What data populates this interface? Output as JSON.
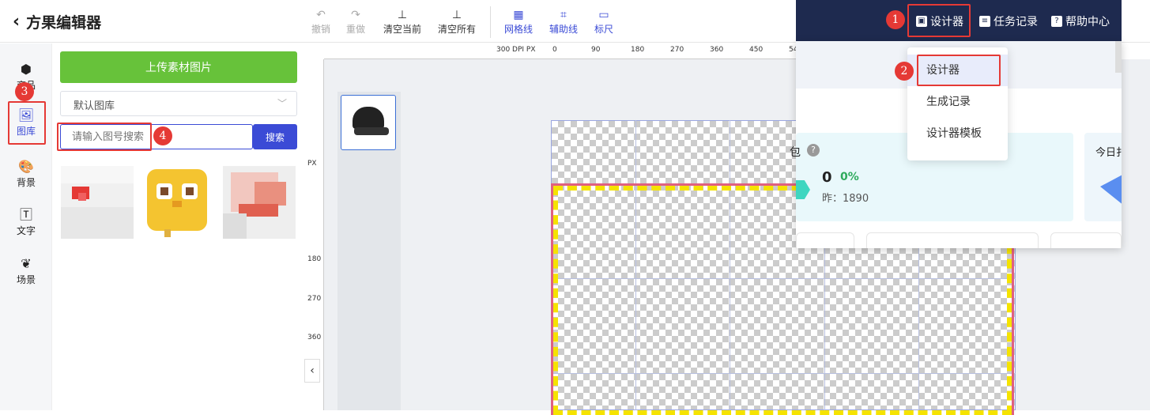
{
  "header": {
    "title": "方果编辑器"
  },
  "toolbar": {
    "undo": "撤销",
    "redo": "重做",
    "clear_current": "清空当前",
    "clear_all": "清空所有",
    "gridlines": "网格线",
    "guides": "辅助线",
    "ruler": "标尺"
  },
  "left_nav": {
    "items": [
      {
        "label": "商品",
        "icon": "box-icon"
      },
      {
        "label": "图库",
        "icon": "image-icon"
      },
      {
        "label": "背景",
        "icon": "palette-icon"
      },
      {
        "label": "文字",
        "icon": "text-icon"
      },
      {
        "label": "场景",
        "icon": "leaf-icon"
      }
    ]
  },
  "panel": {
    "upload_label": "上传素材图片",
    "library_select": "默认图库",
    "search_placeholder": "请输入图号搜索",
    "search_button": "搜索"
  },
  "ruler": {
    "top_prefix": "300 DPI  PX",
    "top_ticks": [
      "0",
      "90",
      "180",
      "270",
      "360",
      "450",
      "54"
    ],
    "left_unit": "PX",
    "left_ticks": [
      "180",
      "270",
      "360"
    ]
  },
  "dashboard": {
    "nav": {
      "designer": "设计器",
      "tasks": "任务记录",
      "help": "帮助中心"
    },
    "dropdown": [
      "设计器",
      "生成记录",
      "设计器模板"
    ],
    "stat_label_fragment": "包",
    "stat_value": "0",
    "stat_percent": "0%",
    "stat_yesterday": "昨：1890",
    "stat2_label_fragment": "今日扌"
  },
  "annotations": {
    "badges": [
      "1",
      "2",
      "3",
      "4"
    ]
  },
  "colors": {
    "accent": "#3b4bd6",
    "upload": "#67c23a",
    "dashbar": "#1e2a4f",
    "annotation": "#e53935",
    "stat_green": "#2eaa5c"
  }
}
